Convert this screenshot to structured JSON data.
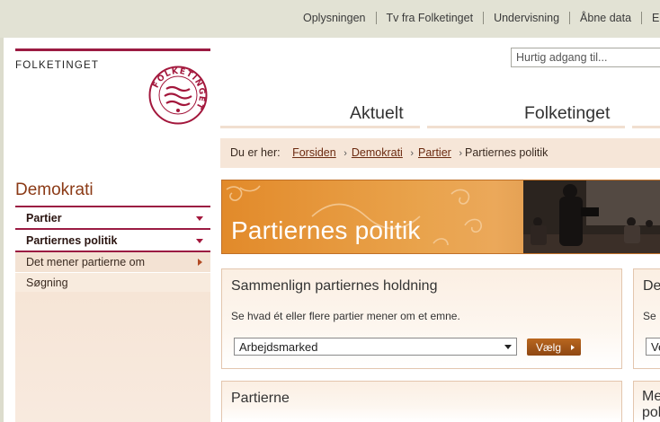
{
  "utility_nav": [
    "Oplysningen",
    "Tv fra Folketinget",
    "Undervisning",
    "Åbne data",
    "En"
  ],
  "logo": {
    "text": "FOLKETINGET",
    "seal_text": "FOLKETINGET"
  },
  "search": {
    "placeholder": "Hurtig adgang til..."
  },
  "main_nav": [
    "Aktuelt",
    "Folketinget"
  ],
  "breadcrumb": {
    "prefix": "Du er her:",
    "items": [
      "Forsiden",
      "Demokrati",
      "Partier"
    ],
    "current": "Partiernes politik",
    "separator": "›"
  },
  "sidebar": {
    "title": "Demokrati",
    "items": [
      {
        "label": "Partier"
      },
      {
        "label": "Partiernes politik"
      },
      {
        "label": "Det mener partierne om"
      },
      {
        "label": "Søgning"
      }
    ]
  },
  "banner": {
    "title": "Partiernes politik"
  },
  "compare_box": {
    "title": "Sammenlign partiernes holdning",
    "description": "Se hvad ét eller flere partier mener om et emne.",
    "select_value": "Arbejdsmarked",
    "button_label": "Vælg"
  },
  "second_box": {
    "title_partial": "De",
    "desc_partial": "Se",
    "select_partial": "Ve"
  },
  "parties_box": {
    "title": "Partierne"
  },
  "fourth_box": {
    "line1": "Me",
    "line2": "pol"
  },
  "colors": {
    "brand": "#9b1b42",
    "accent": "#e28a2a",
    "link": "#6b2a10"
  }
}
